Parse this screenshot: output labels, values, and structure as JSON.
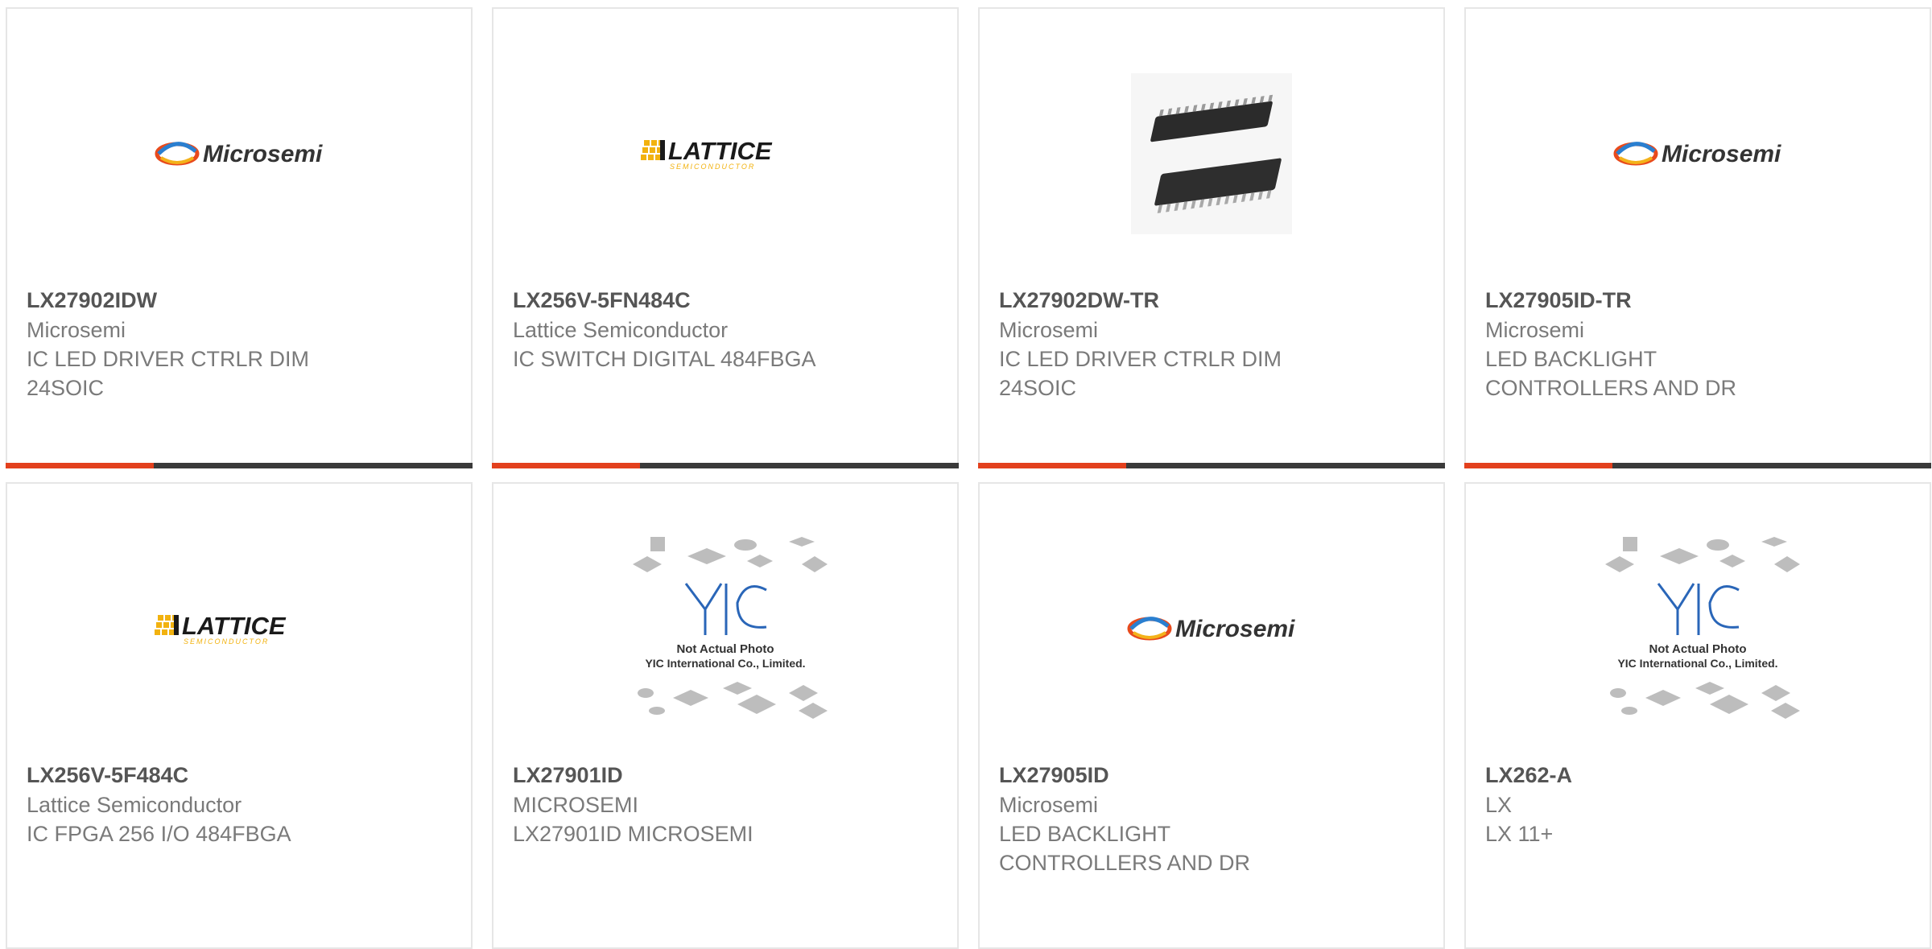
{
  "colors": {
    "accent_bar": "#e3401d",
    "dark_bar": "#3a3a3a",
    "part_number_text": "#555555",
    "secondary_text": "#7a7a7a",
    "card_border": "#e6e6e6"
  },
  "products": [
    {
      "part_number": "LX27902IDW",
      "manufacturer": "Microsemi",
      "description": "IC LED DRIVER CTRLR DIM 24SOIC",
      "image": "microsemi-logo",
      "image_text": "Microsemi"
    },
    {
      "part_number": "LX256V-5FN484C",
      "manufacturer": "Lattice Semiconductor",
      "description": "IC SWITCH DIGITAL 484FBGA",
      "image": "lattice-logo",
      "image_text": "LATTICE",
      "image_subtext": "SEMICONDUCTOR"
    },
    {
      "part_number": "LX27902DW-TR",
      "manufacturer": "Microsemi",
      "description": "IC LED DRIVER CTRLR DIM 24SOIC",
      "image": "soic-chip-photo"
    },
    {
      "part_number": "LX27905ID-TR",
      "manufacturer": "Microsemi",
      "description": "LED BACKLIGHT CONTROLLERS AND DR",
      "image": "microsemi-logo",
      "image_text": "Microsemi"
    },
    {
      "part_number": "LX256V-5F484C",
      "manufacturer": "Lattice Semiconductor",
      "description": "IC FPGA 256 I/O 484FBGA",
      "image": "lattice-logo",
      "image_text": "LATTICE",
      "image_subtext": "SEMICONDUCTOR"
    },
    {
      "part_number": "LX27901ID",
      "manufacturer": "MICROSEMI",
      "description": "LX27901ID MICROSEMI",
      "image": "placeholder-photo",
      "image_text": "Not Actual Photo",
      "image_subtext": "YIC International Co., Limited."
    },
    {
      "part_number": "LX27905ID",
      "manufacturer": "Microsemi",
      "description": "LED BACKLIGHT CONTROLLERS AND DR",
      "image": "microsemi-logo",
      "image_text": "Microsemi"
    },
    {
      "part_number": "LX262-A",
      "manufacturer": "LX",
      "description": "LX 11+",
      "image": "placeholder-photo",
      "image_text": "Not Actual Photo",
      "image_subtext": "YIC International Co., Limited."
    }
  ]
}
